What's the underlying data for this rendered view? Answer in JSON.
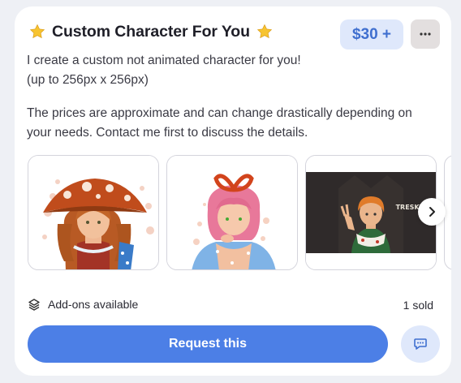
{
  "listing": {
    "title": "Custom Character For You",
    "title_icon": "star-emoji",
    "price": "$30 +",
    "more_icon": "ellipsis-icon",
    "description_line1": "I create a custom not animated character for you!",
    "description_line2": "(up to 256px x 256px)",
    "description_para2": "The prices are approximate and can change drastically depending on your needs. Contact me first to discuss the details.",
    "gallery_thumbnails": [
      {
        "subject": "pixel art girl with mushroom hat"
      },
      {
        "subject": "pixel art girl with pink hair and bow"
      },
      {
        "subject": "pixel art character with watermark"
      }
    ],
    "watermark": "TRESKY",
    "addons_label": "Add-ons available",
    "sold_count": "1 sold",
    "request_button": "Request this",
    "colors": {
      "accent": "#4c7fe6",
      "price_bg": "#dfe8fb",
      "price_text": "#3f6fcf"
    }
  }
}
